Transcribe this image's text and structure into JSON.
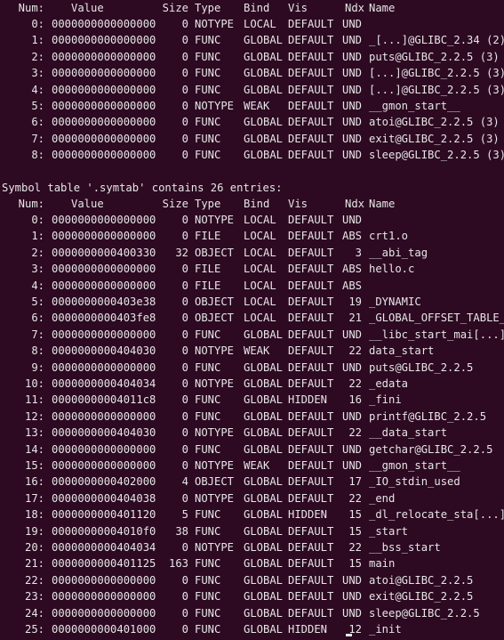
{
  "theme": {
    "background": "#2d0922",
    "foreground": "#e6e6e6"
  },
  "dynsym": {
    "headers": {
      "num": "Num:",
      "value": "Value",
      "size": "Size",
      "type": "Type",
      "bind": "Bind",
      "vis": "Vis",
      "ndx": "Ndx",
      "name": "Name"
    },
    "rows": [
      [
        "0:",
        "0000000000000000",
        "0",
        "NOTYPE",
        "LOCAL",
        "DEFAULT",
        "UND",
        ""
      ],
      [
        "1:",
        "0000000000000000",
        "0",
        "FUNC",
        "GLOBAL",
        "DEFAULT",
        "UND",
        "_[...]@GLIBC_2.34 (2)"
      ],
      [
        "2:",
        "0000000000000000",
        "0",
        "FUNC",
        "GLOBAL",
        "DEFAULT",
        "UND",
        "puts@GLIBC_2.2.5 (3)"
      ],
      [
        "3:",
        "0000000000000000",
        "0",
        "FUNC",
        "GLOBAL",
        "DEFAULT",
        "UND",
        "[...]@GLIBC_2.2.5 (3)"
      ],
      [
        "4:",
        "0000000000000000",
        "0",
        "FUNC",
        "GLOBAL",
        "DEFAULT",
        "UND",
        "[...]@GLIBC_2.2.5 (3)"
      ],
      [
        "5:",
        "0000000000000000",
        "0",
        "NOTYPE",
        "WEAK",
        "DEFAULT",
        "UND",
        "__gmon_start__"
      ],
      [
        "6:",
        "0000000000000000",
        "0",
        "FUNC",
        "GLOBAL",
        "DEFAULT",
        "UND",
        "atoi@GLIBC_2.2.5 (3)"
      ],
      [
        "7:",
        "0000000000000000",
        "0",
        "FUNC",
        "GLOBAL",
        "DEFAULT",
        "UND",
        "exit@GLIBC_2.2.5 (3)"
      ],
      [
        "8:",
        "0000000000000000",
        "0",
        "FUNC",
        "GLOBAL",
        "DEFAULT",
        "UND",
        "sleep@GLIBC_2.2.5 (3)"
      ]
    ]
  },
  "symtab": {
    "caption": "Symbol table '.symtab' contains 26 entries:",
    "headers": {
      "num": "Num:",
      "value": "Value",
      "size": "Size",
      "type": "Type",
      "bind": "Bind",
      "vis": "Vis",
      "ndx": "Ndx",
      "name": "Name"
    },
    "rows": [
      [
        "0:",
        "0000000000000000",
        "0",
        "NOTYPE",
        "LOCAL",
        "DEFAULT",
        "UND",
        ""
      ],
      [
        "1:",
        "0000000000000000",
        "0",
        "FILE",
        "LOCAL",
        "DEFAULT",
        "ABS",
        "crt1.o"
      ],
      [
        "2:",
        "0000000000400330",
        "32",
        "OBJECT",
        "LOCAL",
        "DEFAULT",
        "3",
        "__abi_tag"
      ],
      [
        "3:",
        "0000000000000000",
        "0",
        "FILE",
        "LOCAL",
        "DEFAULT",
        "ABS",
        "hello.c"
      ],
      [
        "4:",
        "0000000000000000",
        "0",
        "FILE",
        "LOCAL",
        "DEFAULT",
        "ABS",
        ""
      ],
      [
        "5:",
        "0000000000403e38",
        "0",
        "OBJECT",
        "LOCAL",
        "DEFAULT",
        "19",
        "_DYNAMIC"
      ],
      [
        "6:",
        "0000000000403fe8",
        "0",
        "OBJECT",
        "LOCAL",
        "DEFAULT",
        "21",
        "_GLOBAL_OFFSET_TABLE_"
      ],
      [
        "7:",
        "0000000000000000",
        "0",
        "FUNC",
        "GLOBAL",
        "DEFAULT",
        "UND",
        "__libc_start_mai[...]"
      ],
      [
        "8:",
        "0000000000404030",
        "0",
        "NOTYPE",
        "WEAK",
        "DEFAULT",
        "22",
        "data_start"
      ],
      [
        "9:",
        "0000000000000000",
        "0",
        "FUNC",
        "GLOBAL",
        "DEFAULT",
        "UND",
        "puts@GLIBC_2.2.5"
      ],
      [
        "10:",
        "0000000000404034",
        "0",
        "NOTYPE",
        "GLOBAL",
        "DEFAULT",
        "22",
        "_edata"
      ],
      [
        "11:",
        "00000000004011c8",
        "0",
        "FUNC",
        "GLOBAL",
        "HIDDEN",
        "16",
        "_fini"
      ],
      [
        "12:",
        "0000000000000000",
        "0",
        "FUNC",
        "GLOBAL",
        "DEFAULT",
        "UND",
        "printf@GLIBC_2.2.5"
      ],
      [
        "13:",
        "0000000000404030",
        "0",
        "NOTYPE",
        "GLOBAL",
        "DEFAULT",
        "22",
        "__data_start"
      ],
      [
        "14:",
        "0000000000000000",
        "0",
        "FUNC",
        "GLOBAL",
        "DEFAULT",
        "UND",
        "getchar@GLIBC_2.2.5"
      ],
      [
        "15:",
        "0000000000000000",
        "0",
        "NOTYPE",
        "WEAK",
        "DEFAULT",
        "UND",
        "__gmon_start__"
      ],
      [
        "16:",
        "0000000000402000",
        "4",
        "OBJECT",
        "GLOBAL",
        "DEFAULT",
        "17",
        "_IO_stdin_used"
      ],
      [
        "17:",
        "0000000000404038",
        "0",
        "NOTYPE",
        "GLOBAL",
        "DEFAULT",
        "22",
        "_end"
      ],
      [
        "18:",
        "0000000000401120",
        "5",
        "FUNC",
        "GLOBAL",
        "HIDDEN",
        "15",
        "_dl_relocate_sta[...]"
      ],
      [
        "19:",
        "00000000004010f0",
        "38",
        "FUNC",
        "GLOBAL",
        "DEFAULT",
        "15",
        "_start"
      ],
      [
        "20:",
        "0000000000404034",
        "0",
        "NOTYPE",
        "GLOBAL",
        "DEFAULT",
        "22",
        "__bss_start"
      ],
      [
        "21:",
        "0000000000401125",
        "163",
        "FUNC",
        "GLOBAL",
        "DEFAULT",
        "15",
        "main"
      ],
      [
        "22:",
        "0000000000000000",
        "0",
        "FUNC",
        "GLOBAL",
        "DEFAULT",
        "UND",
        "atoi@GLIBC_2.2.5"
      ],
      [
        "23:",
        "0000000000000000",
        "0",
        "FUNC",
        "GLOBAL",
        "DEFAULT",
        "UND",
        "exit@GLIBC_2.2.5"
      ],
      [
        "24:",
        "0000000000000000",
        "0",
        "FUNC",
        "GLOBAL",
        "DEFAULT",
        "UND",
        "sleep@GLIBC_2.2.5"
      ],
      [
        "25:",
        "0000000000401000",
        "0",
        "FUNC",
        "GLOBAL",
        "HIDDEN",
        "12",
        "_init"
      ]
    ]
  }
}
